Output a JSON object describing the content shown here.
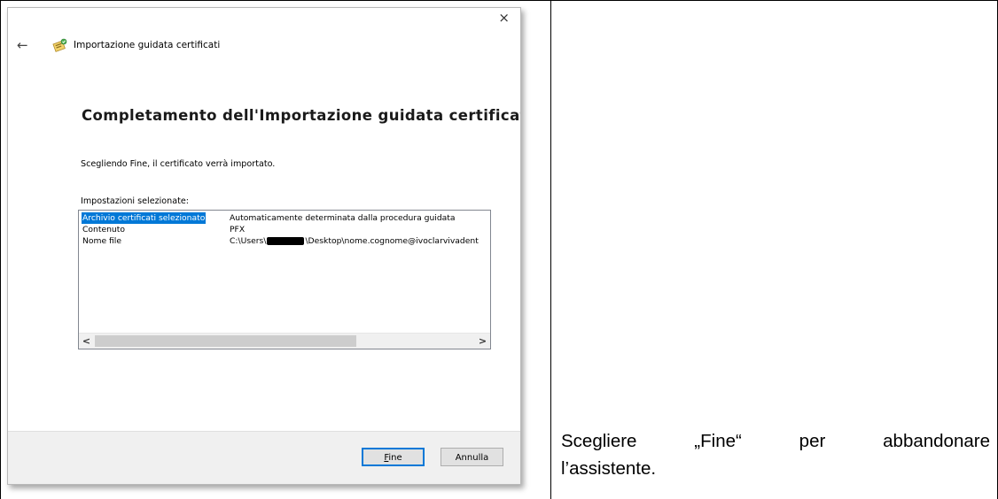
{
  "dialog": {
    "close_glyph": "×",
    "back_glyph": "←",
    "window_title": "Importazione guidata certificati",
    "icon": "certificate-wizard-icon",
    "heading": "Completamento dell'Importazione guidata certificati",
    "description": "Scegliendo Fine, il certificato verrà importato.",
    "settings_label": "Impostazioni selezionate:",
    "settings": [
      {
        "key": "Archivio certificati selezionato",
        "value": "Automaticamente determinata dalla procedura guidata",
        "selected": true
      },
      {
        "key": "Contenuto",
        "value": "PFX",
        "selected": false
      },
      {
        "key": "Nome file",
        "value_prefix": "C:\\Users\\",
        "value_suffix": "\\Desktop\\nome.cognome@ivoclarvivadent",
        "redacted": true,
        "selected": false
      }
    ],
    "scroll_left_glyph": "<",
    "scroll_right_glyph": ">",
    "buttons": {
      "finish": "Fine",
      "cancel": "Annulla"
    },
    "accent_color": "#0078d7"
  },
  "caption": {
    "line1_words": [
      "Scegliere",
      "„Fine“",
      "per",
      "abbandonare"
    ],
    "line2": "l’assistente."
  }
}
